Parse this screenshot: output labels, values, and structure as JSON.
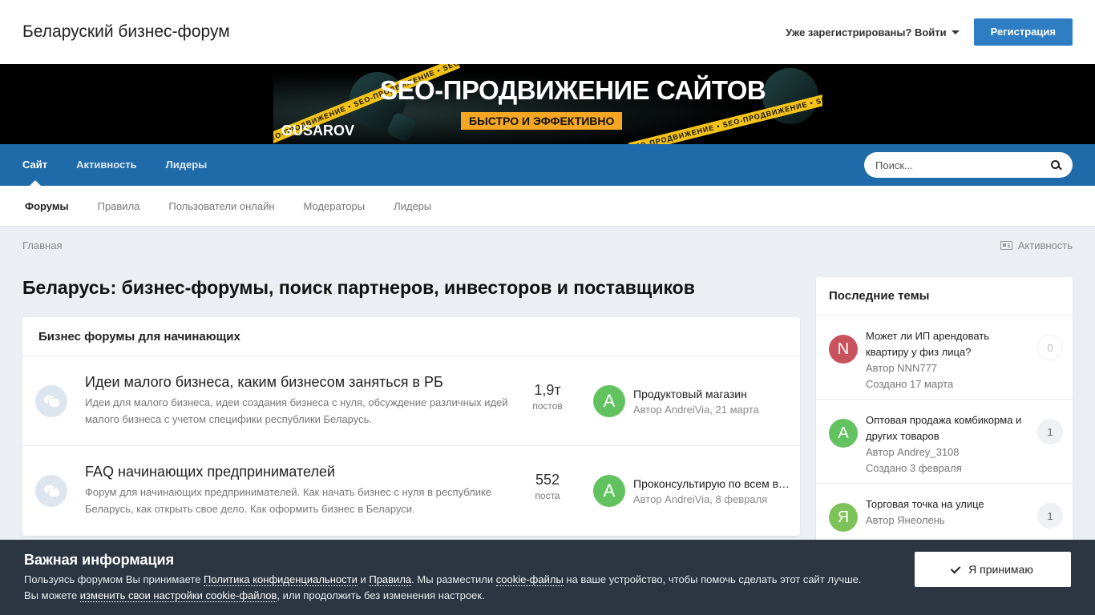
{
  "header": {
    "site_title": "Беларуский бизнес-форум",
    "signin_label": "Уже зарегистрированы? Войти",
    "register_label": "Регистрация"
  },
  "banner": {
    "title": "SEO-ПРОДВИЖЕНИЕ САЙТОВ",
    "subtitle": "БЫСТРО И ЭФФЕКТИВНО",
    "brand": "GUSAROV",
    "tape_text": "SEO-ПРОДВИЖЕНИЕ • SEO-ПРОДВИЖЕНИЕ • SEO-ПРОДВИЖЕНИЕ • SEO-ПРОДВИЖЕНИЕ"
  },
  "nav": {
    "items": [
      {
        "label": "Сайт"
      },
      {
        "label": "Активность"
      },
      {
        "label": "Лидеры"
      }
    ],
    "search_placeholder": "Поиск..."
  },
  "subnav": {
    "items": [
      {
        "label": "Форумы"
      },
      {
        "label": "Правила"
      },
      {
        "label": "Пользователи онлайн"
      },
      {
        "label": "Модераторы"
      },
      {
        "label": "Лидеры"
      }
    ]
  },
  "breadcrumb": {
    "home": "Главная",
    "activity": "Активность"
  },
  "main": {
    "page_title": "Беларусь: бизнес-форумы, поиск партнеров, инвесторов и поставщиков",
    "section_title": "Бизнес форумы для начинающих",
    "forums": [
      {
        "title": "Идеи малого бизнеса, каким бизнесом заняться в РБ",
        "description": "Идеи для малого бизнеса, идеи создания бизнеса с нуля, обсуждение различных идей малого бизнеса с учетом специфики республики Беларусь.",
        "count": "1,9т",
        "count_label": "постов",
        "avatar": "A",
        "last_title": "Продуктовый магазин",
        "last_meta": "Автор AndreiVia, 21 марта"
      },
      {
        "title": "FAQ начинающих предпринимателей",
        "description": "Форум для начинающих предпринимателей. Как начать бизнес с нуля в республике Беларусь, как открыть свое дело. Как оформить бизнес в Беларуси.",
        "count": "552",
        "count_label": "поста",
        "avatar": "A",
        "last_title": "Проконсультирую по всем вопросам",
        "last_meta": "Автор AndreiVia, 8 февраля"
      }
    ]
  },
  "sidebar": {
    "title": "Последние темы",
    "topics": [
      {
        "avatar": "N",
        "avatar_color": "#c9535c",
        "title": "Может ли ИП арендовать квартиру у физ лица?",
        "author": "Автор NNN777",
        "date": "Создано 17 марта",
        "count": "0"
      },
      {
        "avatar": "A",
        "avatar_color": "#62c25f",
        "title": "Оптовая продажа комбикорма и других товаров",
        "author": "Автор Andrey_3108",
        "date": "Создано 3 февраля",
        "count": "1"
      },
      {
        "avatar": "Я",
        "avatar_color": "#7dc35a",
        "title": "Торговая точка на улице",
        "author": "Автор Янеолень",
        "date": "",
        "count": "1"
      }
    ]
  },
  "cookie": {
    "title": "Важная информация",
    "text1": "Пользуясь форумом Вы принимаете ",
    "link_privacy": "Политика конфиденциальности",
    "text2": " и ",
    "link_rules": "Правила",
    "text3": ". Мы разместили ",
    "link_cookies": "cookie-файлы",
    "text4": " на ваше устройство, чтобы помочь сделать этот сайт лучше.",
    "text5": "Вы можете ",
    "link_settings": "изменить свои настройки cookie-файлов",
    "text6": ", или продолжить без изменения настроек.",
    "accept_label": "Я принимаю"
  },
  "colors": {
    "nav_blue": "#1f6aa8",
    "button_blue": "#2f7ec4",
    "avatar_green": "#62c25f",
    "cookie_bg": "#2b3642"
  }
}
